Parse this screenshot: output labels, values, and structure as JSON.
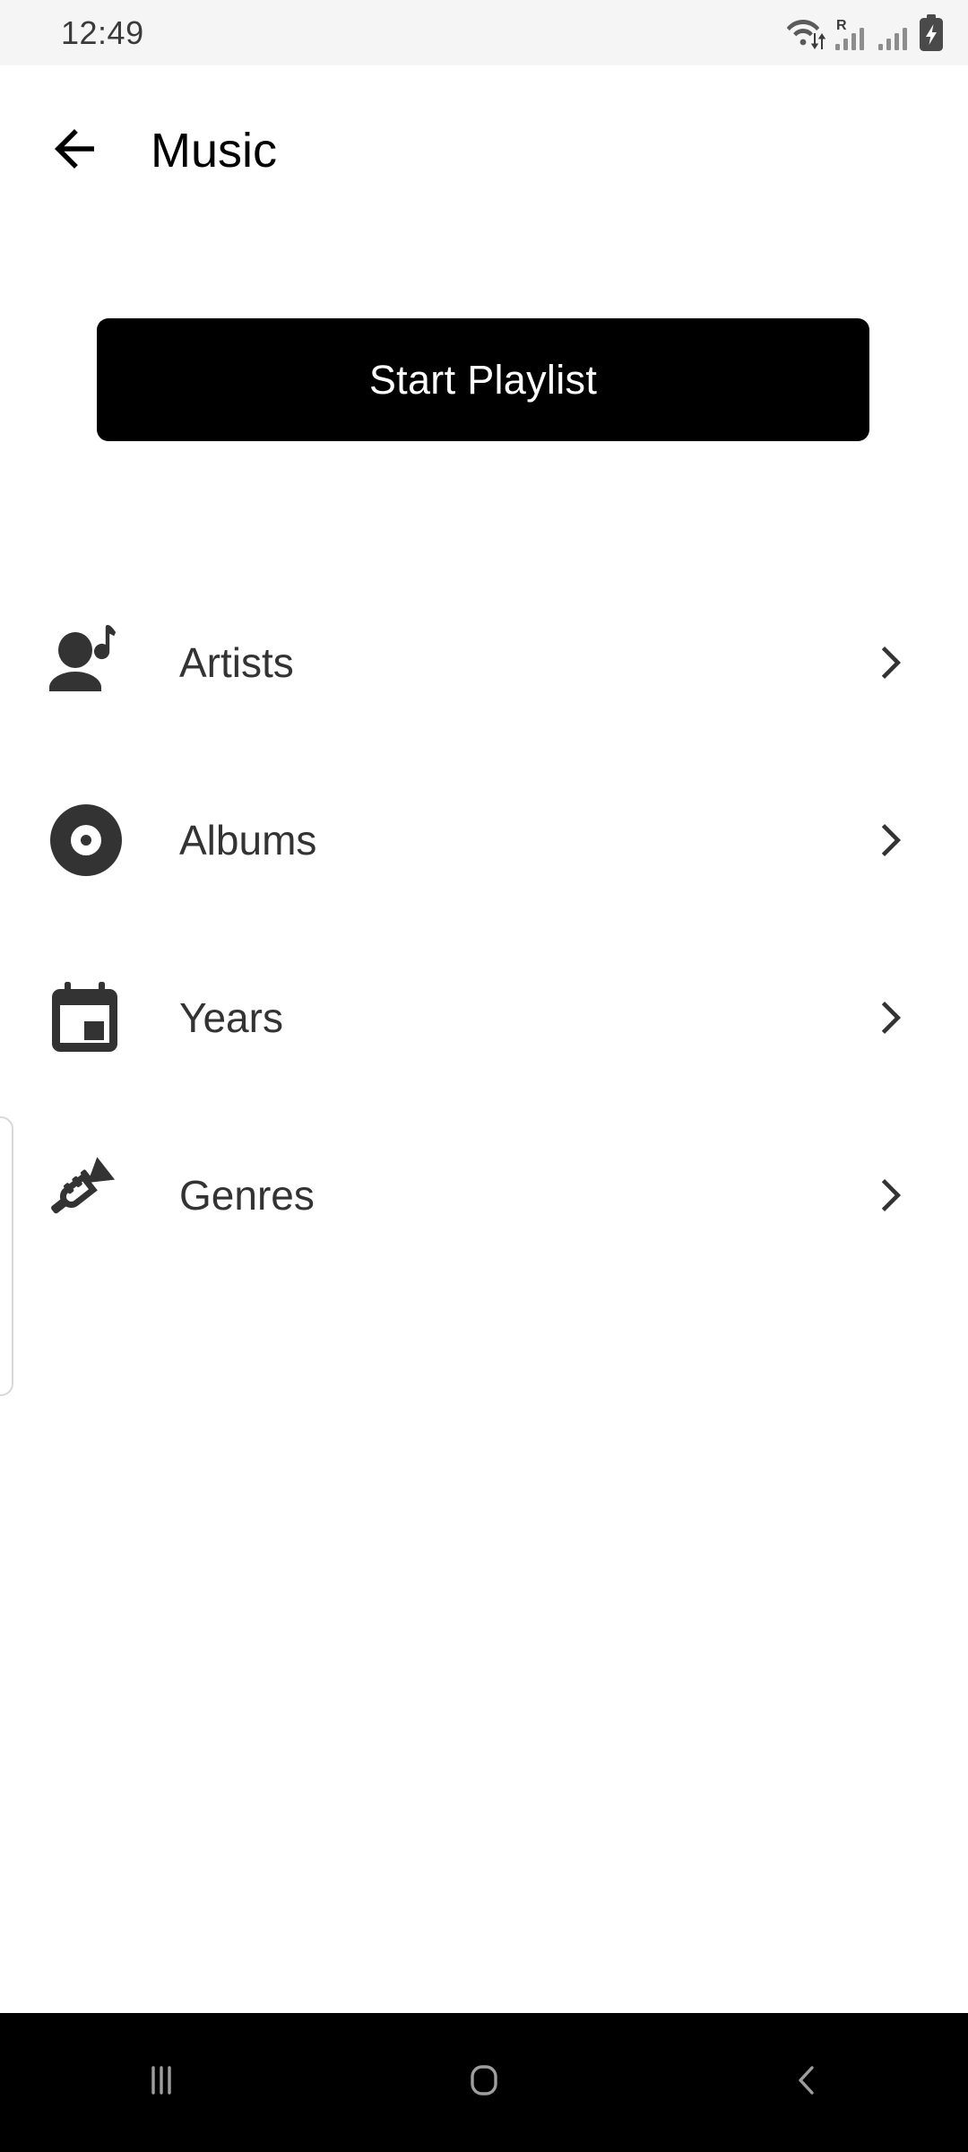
{
  "status_bar": {
    "time": "12:49",
    "icons": [
      {
        "name": "wifi-data-icon",
        "label": "Wi-Fi with data transfer arrows"
      },
      {
        "name": "signal-roaming-icon",
        "label": "R",
        "roaming_letter": "R"
      },
      {
        "name": "signal-bars-icon",
        "label": "Mobile signal bars"
      },
      {
        "name": "battery-charging-icon",
        "label": "Battery charging"
      }
    ],
    "background": "#f5f5f5"
  },
  "app_bar": {
    "back_icon": "arrow-left-icon",
    "title": "Music"
  },
  "primary_action": {
    "label": "Start Playlist",
    "background": "#000000",
    "text_color": "#ffffff"
  },
  "list": {
    "items": [
      {
        "label": "Artists",
        "icon": "artist-person-music-note-icon",
        "chevron": "chevron-right-icon"
      },
      {
        "label": "Albums",
        "icon": "vinyl-record-icon",
        "chevron": "chevron-right-icon"
      },
      {
        "label": "Years",
        "icon": "calendar-icon",
        "chevron": "chevron-right-icon"
      },
      {
        "label": "Genres",
        "icon": "trumpet-icon",
        "chevron": "chevron-right-icon"
      }
    ],
    "text_color": "#333333"
  },
  "nav_bar": {
    "background": "#000000",
    "tint": "#9e9e9e",
    "buttons": [
      {
        "name": "recents-button",
        "icon": "recents-bars-icon"
      },
      {
        "name": "home-button",
        "icon": "home-square-icon"
      },
      {
        "name": "back-button",
        "icon": "chevron-left-icon"
      }
    ]
  }
}
